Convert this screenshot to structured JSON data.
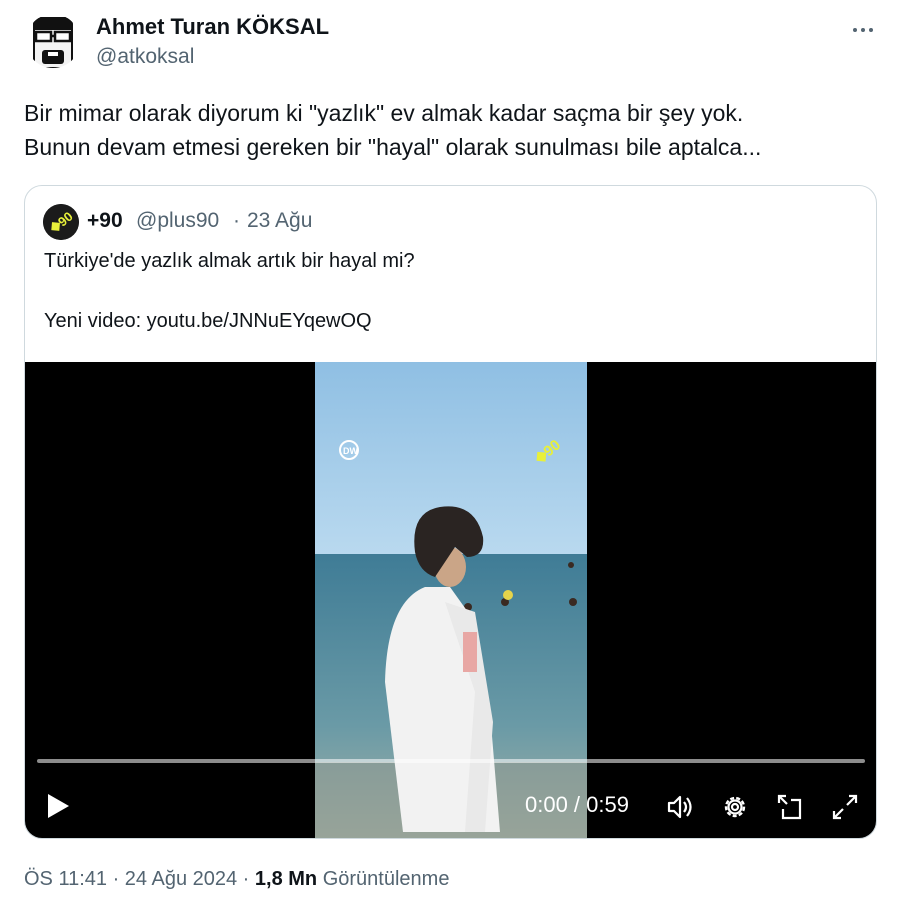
{
  "author": {
    "name": "Ahmet Turan KÖKSAL",
    "handle": "@atkoksal"
  },
  "tweet": {
    "line1": "Bir mimar olarak diyorum ki \"yazlık\" ev almak kadar saçma bir şey yok.",
    "line2": "Bunun devam etmesi gereken bir \"hayal\" olarak sunulması bile aptalca..."
  },
  "quote": {
    "name": "+90",
    "handle": "@plus90",
    "separator": "·",
    "date": "23 Ağu",
    "line1": "Türkiye'de yazlık almak artık bir hayal mi?",
    "line2": "Yeni video: youtu.be/JNNuEYqewOQ"
  },
  "video": {
    "time": "0:00 / 0:59",
    "progress": 0,
    "watermark_left": "DW",
    "watermark_right": "+90"
  },
  "meta": {
    "time": "ÖS 11:41 · 24 Ağu 2024 · ",
    "views": "1,8 Mn",
    "views_label": " Görüntülenme"
  },
  "colors": {
    "text": "#0f1419",
    "secondary": "#536471",
    "border": "#cfd9de",
    "plus90_yellow": "#e8f03a"
  },
  "icons": [
    "more-icon",
    "play-icon",
    "volume-icon",
    "settings-icon",
    "dock-icon",
    "fullscreen-icon"
  ]
}
